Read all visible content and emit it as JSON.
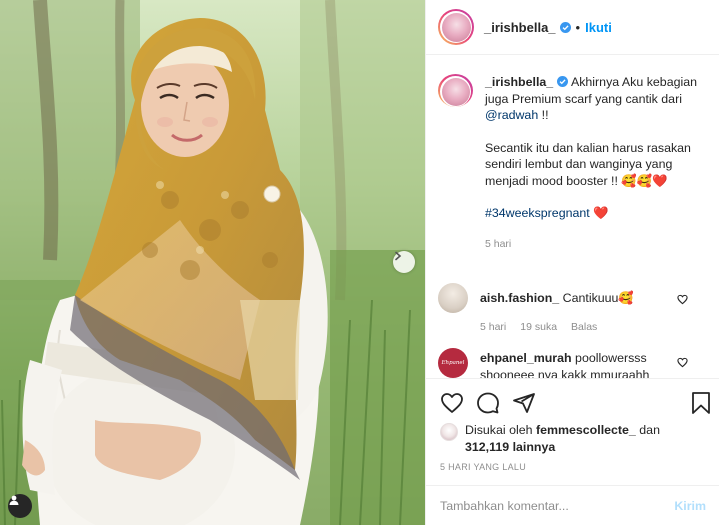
{
  "header": {
    "username": "_irishbella_",
    "separator": "•",
    "follow_label": "Ikuti"
  },
  "caption": {
    "username": "_irishbella_",
    "line1": "Akhirnya Aku kebagian juga Premium scarf yang cantik dari",
    "mention": "@radwah",
    "line1_end": "!!",
    "line2": "Secantik itu dan kalian harus rasakan sendiri lembut dan wanginya yang menjadi mood booster !! 🥰🥰❤️",
    "hashtag": "#34weekspregnant",
    "hashtag_emoji": "❤️",
    "time": "5 hari"
  },
  "comments": [
    {
      "username": "aish.fashion_",
      "text": "Cantikuuu🥰",
      "time": "5 hari",
      "likes": "19 suka",
      "reply_label": "Balas"
    },
    {
      "username": "ehpanel_murah",
      "text": "poollowersss shooneee nya kakk mmuraahh",
      "avatar_text": "Ehpanel"
    }
  ],
  "likes": {
    "prefix": "Disukai oleh",
    "user": "femmescollecte_",
    "middle": "dan",
    "count": "312,119",
    "suffix": "lainnya"
  },
  "date": "5 HARI YANG LALU",
  "comment_input": {
    "placeholder": "Tambahkan komentar...",
    "post_label": "Kirim"
  },
  "colors": {
    "link_blue": "#0095f6",
    "mention_blue": "#00376b",
    "secondary_text": "#8e8e8e",
    "post_disabled": "#b2dffc"
  }
}
